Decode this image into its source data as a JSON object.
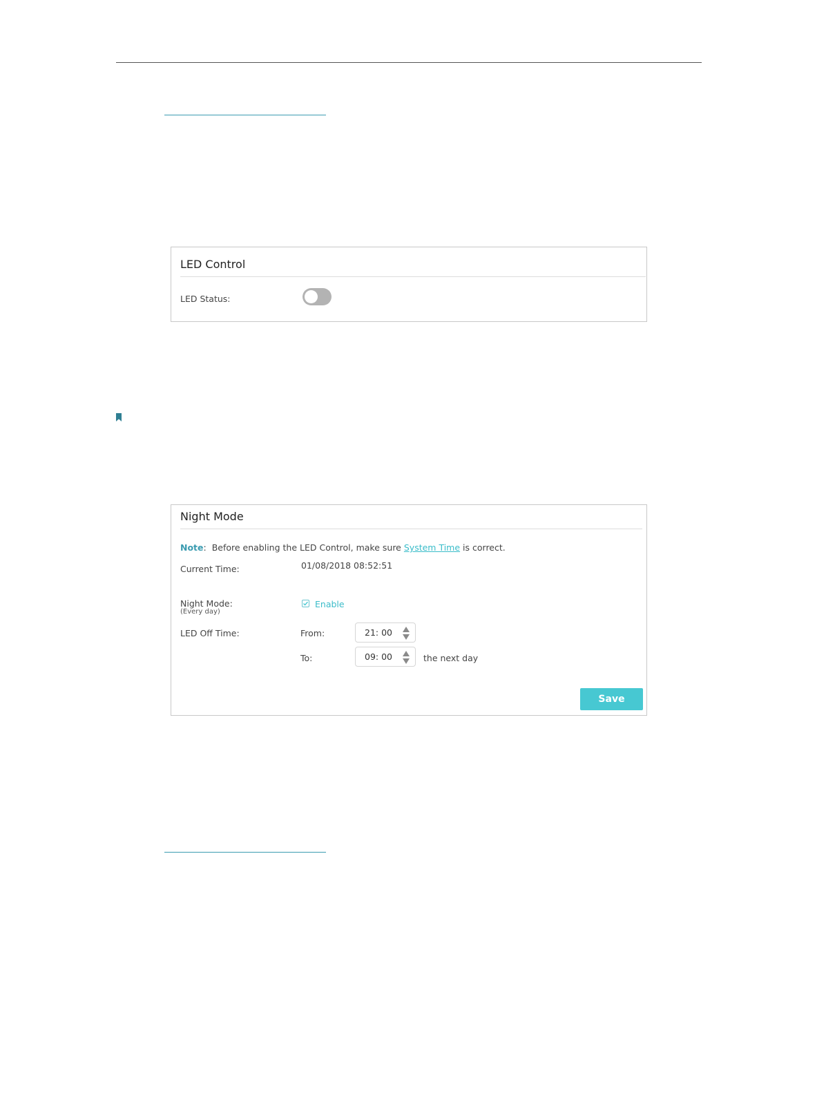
{
  "led_control": {
    "title": "LED Control",
    "status_label": "LED Status:",
    "status_on": false
  },
  "night_mode": {
    "title": "Night Mode",
    "note": {
      "key": "Note",
      "before": "Before enabling the LED Control, make sure",
      "link": "System Time",
      "after": "is correct."
    },
    "current_time_label": "Current Time:",
    "current_time_value": "01/08/2018 08:52:51",
    "night_mode_label": "Night Mode:",
    "night_mode_sublabel": "(Every day)",
    "enable_label": "Enable",
    "enabled": true,
    "led_off_time_label": "LED Off Time:",
    "from_label": "From:",
    "from_value": "21: 00",
    "to_label": "To:",
    "to_value": "09: 00",
    "next_day_label": "the next day",
    "save_label": "Save"
  },
  "colors": {
    "accent": "#47c8d2",
    "link": "#38bcc9",
    "toggle_off": "#b3b3b3"
  }
}
